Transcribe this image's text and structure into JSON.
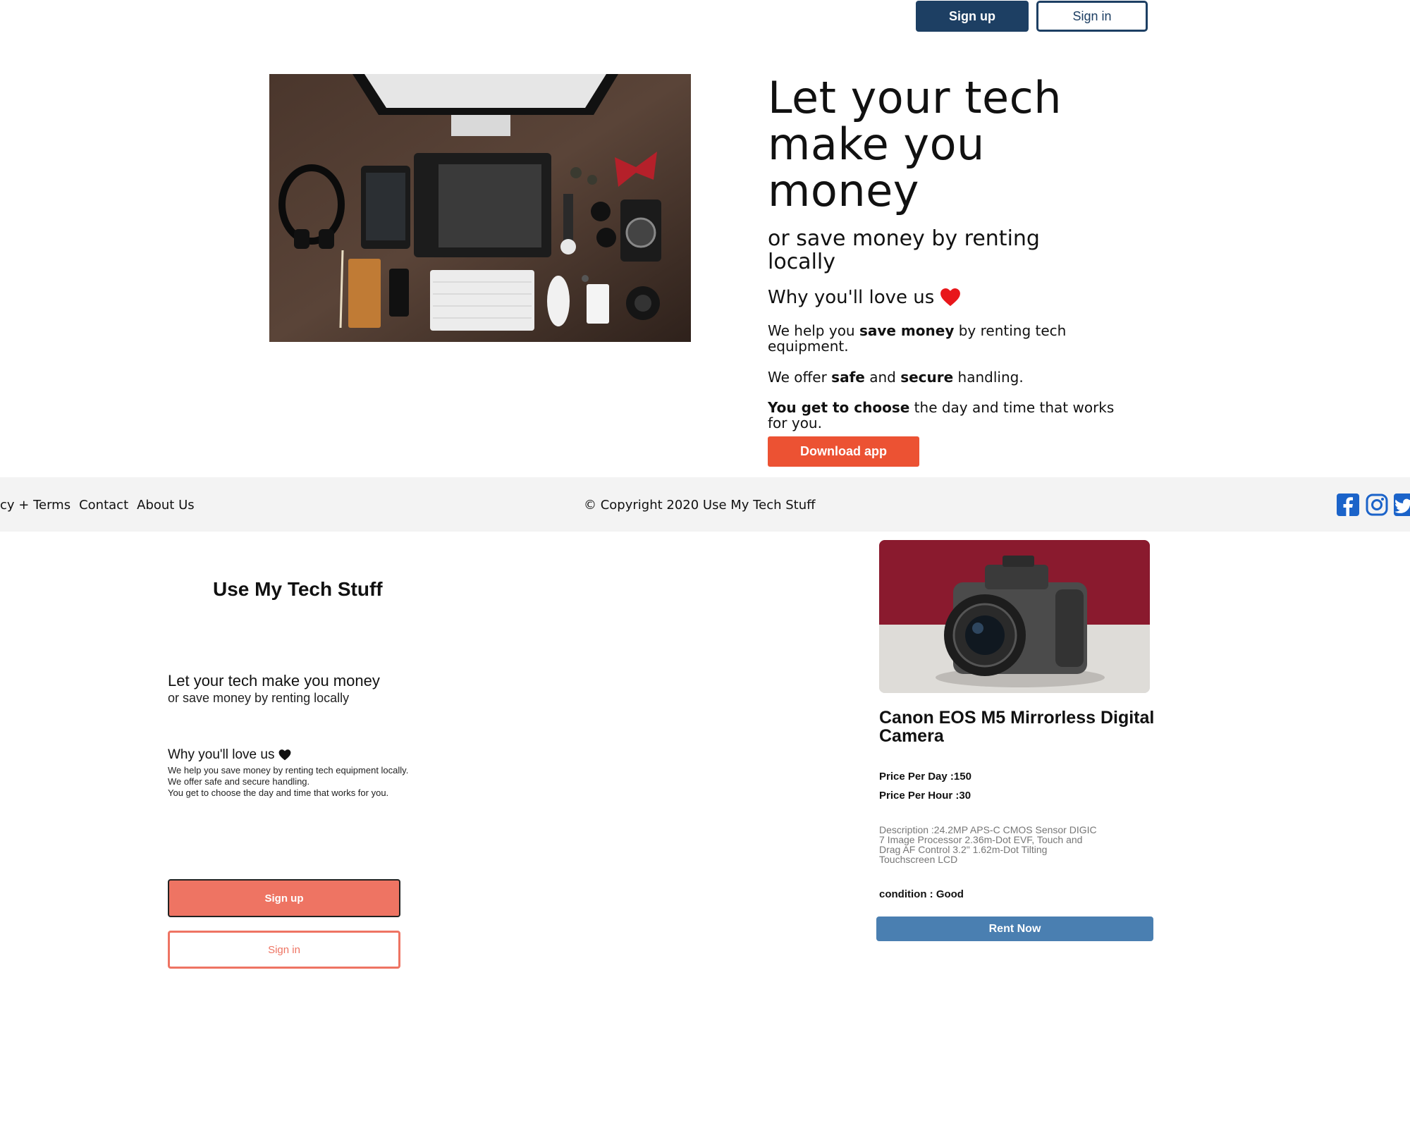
{
  "header": {
    "signup_label": "Sign up",
    "signin_label": "Sign in"
  },
  "hero": {
    "title": "Let your tech make you money",
    "subtitle": "or save money by renting locally",
    "why": "Why you'll love us",
    "line1_pre": "We help you ",
    "line1_bold": "save money",
    "line1_post": " by renting tech equipment.",
    "line2_pre": "We offer ",
    "line2_bold1": "safe",
    "line2_mid": " and ",
    "line2_bold2": "secure",
    "line2_post": " handling.",
    "line3_bold": "You get to choose",
    "line3_post": " the day and time that works for you.",
    "download_label": "Download app"
  },
  "footer": {
    "links": [
      "cy + Terms",
      "Contact",
      "About Us"
    ],
    "copyright": "© Copyright 2020 Use My Tech Stuff",
    "social_icons": [
      "facebook-icon",
      "instagram-icon",
      "twitter-icon"
    ]
  },
  "mobile": {
    "brand": "Use My Tech Stuff",
    "title": "Let your tech make you money",
    "subtitle": "or save money by renting locally",
    "why": "Why you'll love us",
    "lines": [
      "We help you save money by renting tech equipment locally.",
      "We offer safe and secure handling.",
      "You get to choose the day and time that works for you."
    ],
    "signup_label": "Sign up",
    "signin_label": "Sign in"
  },
  "product": {
    "name": "Canon EOS M5 Mirrorless Digital Camera",
    "price_day": "Price Per Day :150",
    "price_hour": "Price Per Hour :30",
    "description": "Description :24.2MP APS-C CMOS Sensor DIGIC 7 Image Processor 2.36m-Dot EVF, Touch and Drag AF Control 3.2\" 1.62m-Dot Tilting Touchscreen LCD",
    "condition": "condition : Good",
    "rent_label": "Rent Now"
  },
  "colors": {
    "navy": "#1d3f63",
    "orange": "#ec5233",
    "salmon": "#ee7463",
    "rent_blue": "#4a7fb1",
    "heart_red": "#e8171b"
  }
}
